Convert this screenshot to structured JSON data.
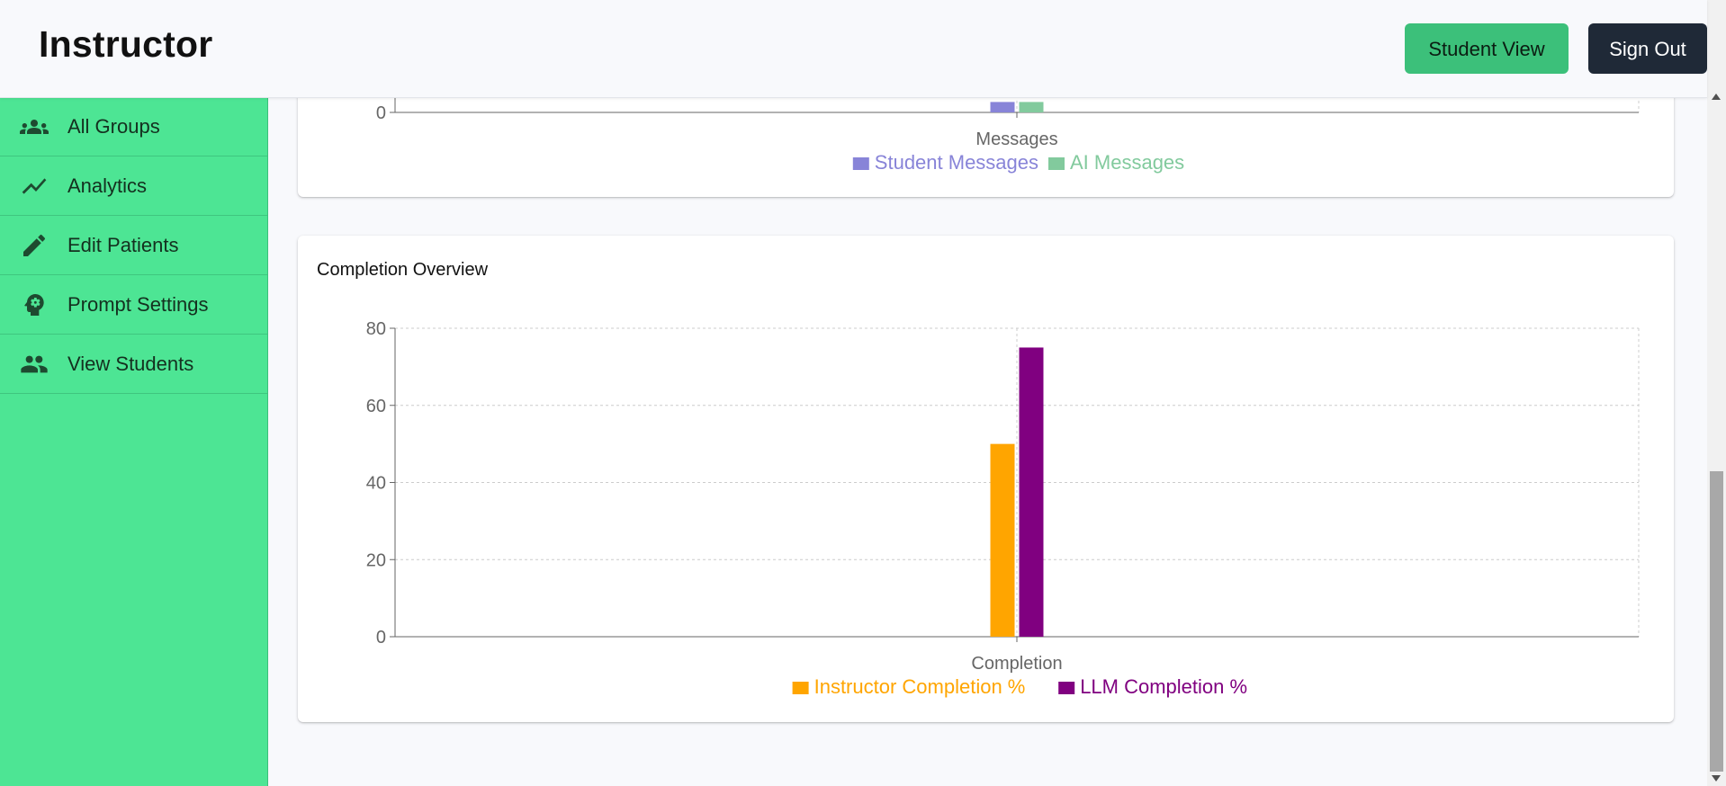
{
  "header": {
    "title": "Instructor",
    "student_view_label": "Student View",
    "sign_out_label": "Sign Out"
  },
  "sidebar": {
    "items": [
      {
        "label": "All Groups",
        "icon": "groups-icon"
      },
      {
        "label": "Analytics",
        "icon": "trending-up-icon"
      },
      {
        "label": "Edit Patients",
        "icon": "pencil-icon"
      },
      {
        "label": "Prompt Settings",
        "icon": "head-gear-icon"
      },
      {
        "label": "View Students",
        "icon": "people-icon"
      }
    ]
  },
  "colors": {
    "sidebar": "#4de594",
    "student_view_button": "#3cc07a",
    "sign_out_button": "#1f2937"
  },
  "chart_data": [
    {
      "type": "bar",
      "categories": [
        "Messages"
      ],
      "series": [
        {
          "name": "Student Messages",
          "color": "#8884d8",
          "values": [
            4
          ]
        },
        {
          "name": "AI Messages",
          "color": "#82ca9d",
          "values": [
            4
          ]
        }
      ],
      "yticks_visible": [
        "0"
      ],
      "xlabel": "",
      "ylabel": "",
      "grid": true,
      "legend": "bottom"
    },
    {
      "type": "bar",
      "title": "Completion Overview",
      "categories": [
        "Completion"
      ],
      "series": [
        {
          "name": "Instructor Completion %",
          "color": "#ffa500",
          "values": [
            50
          ]
        },
        {
          "name": "LLM Completion %",
          "color": "#800080",
          "values": [
            75
          ]
        }
      ],
      "ylim": [
        0,
        80
      ],
      "yticks": [
        "0",
        "20",
        "40",
        "60",
        "80"
      ],
      "xlabel": "",
      "ylabel": "",
      "grid": true,
      "legend": "bottom"
    }
  ]
}
